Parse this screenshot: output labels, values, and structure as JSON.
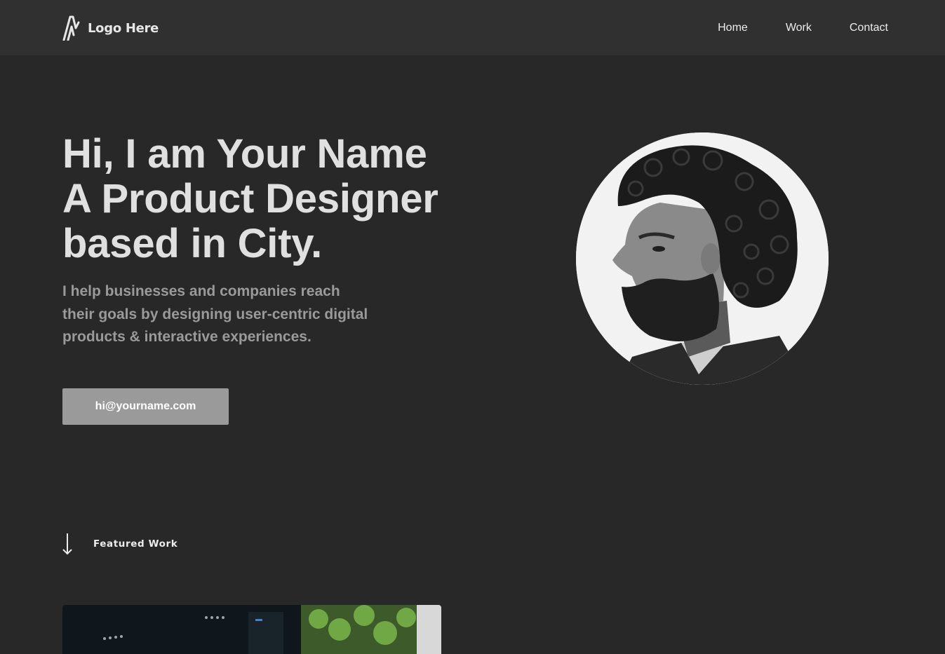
{
  "header": {
    "logo_text": "Logo Here",
    "logo_icon": "zigzag-logo-icon",
    "nav": [
      "Home",
      "Work",
      "Contact"
    ]
  },
  "hero": {
    "headline": [
      "Hi, I am Your Name",
      "A Product Designer",
      "based in City."
    ],
    "subtext": [
      "I help businesses and companies reach",
      "their goals by designing user-centric digital",
      "products & interactive experiences."
    ],
    "cta_label": "hi@yourname.com"
  },
  "featured": {
    "arrow_icon": "arrow-down-icon",
    "label": "Featured Work"
  },
  "colors": {
    "background": "#282828",
    "header_background": "#303030",
    "headline": "#e0e0e0",
    "subtext": "#9a9a9a",
    "button": "#9a9a9a"
  }
}
